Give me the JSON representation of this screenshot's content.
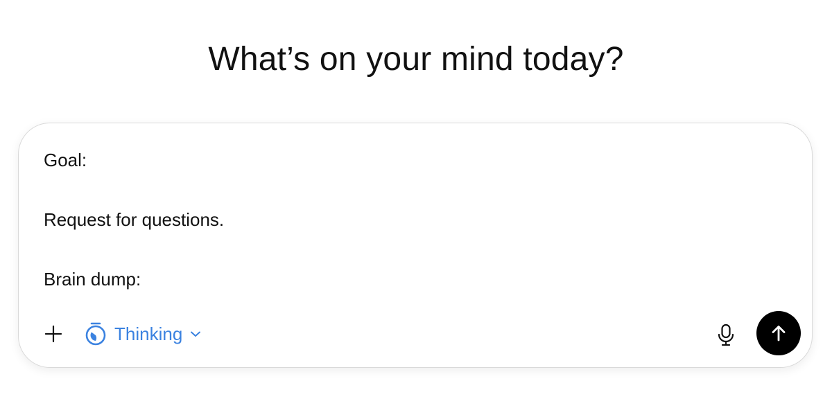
{
  "header": {
    "title": "What’s on your mind today?"
  },
  "composer": {
    "lines": [
      "Goal:",
      "",
      "Request for questions.",
      "",
      "Brain dump:"
    ],
    "toolbar": {
      "add_icon": "plus-icon",
      "mode_icon": "stopwatch-icon",
      "mode_label": "Thinking",
      "mode_dropdown_icon": "chevron-down-icon",
      "voice_icon": "microphone-icon",
      "send_icon": "arrow-up-icon"
    }
  },
  "colors": {
    "accent": "#3b82e0",
    "send_background": "#000000",
    "border": "#d9d9d9"
  }
}
